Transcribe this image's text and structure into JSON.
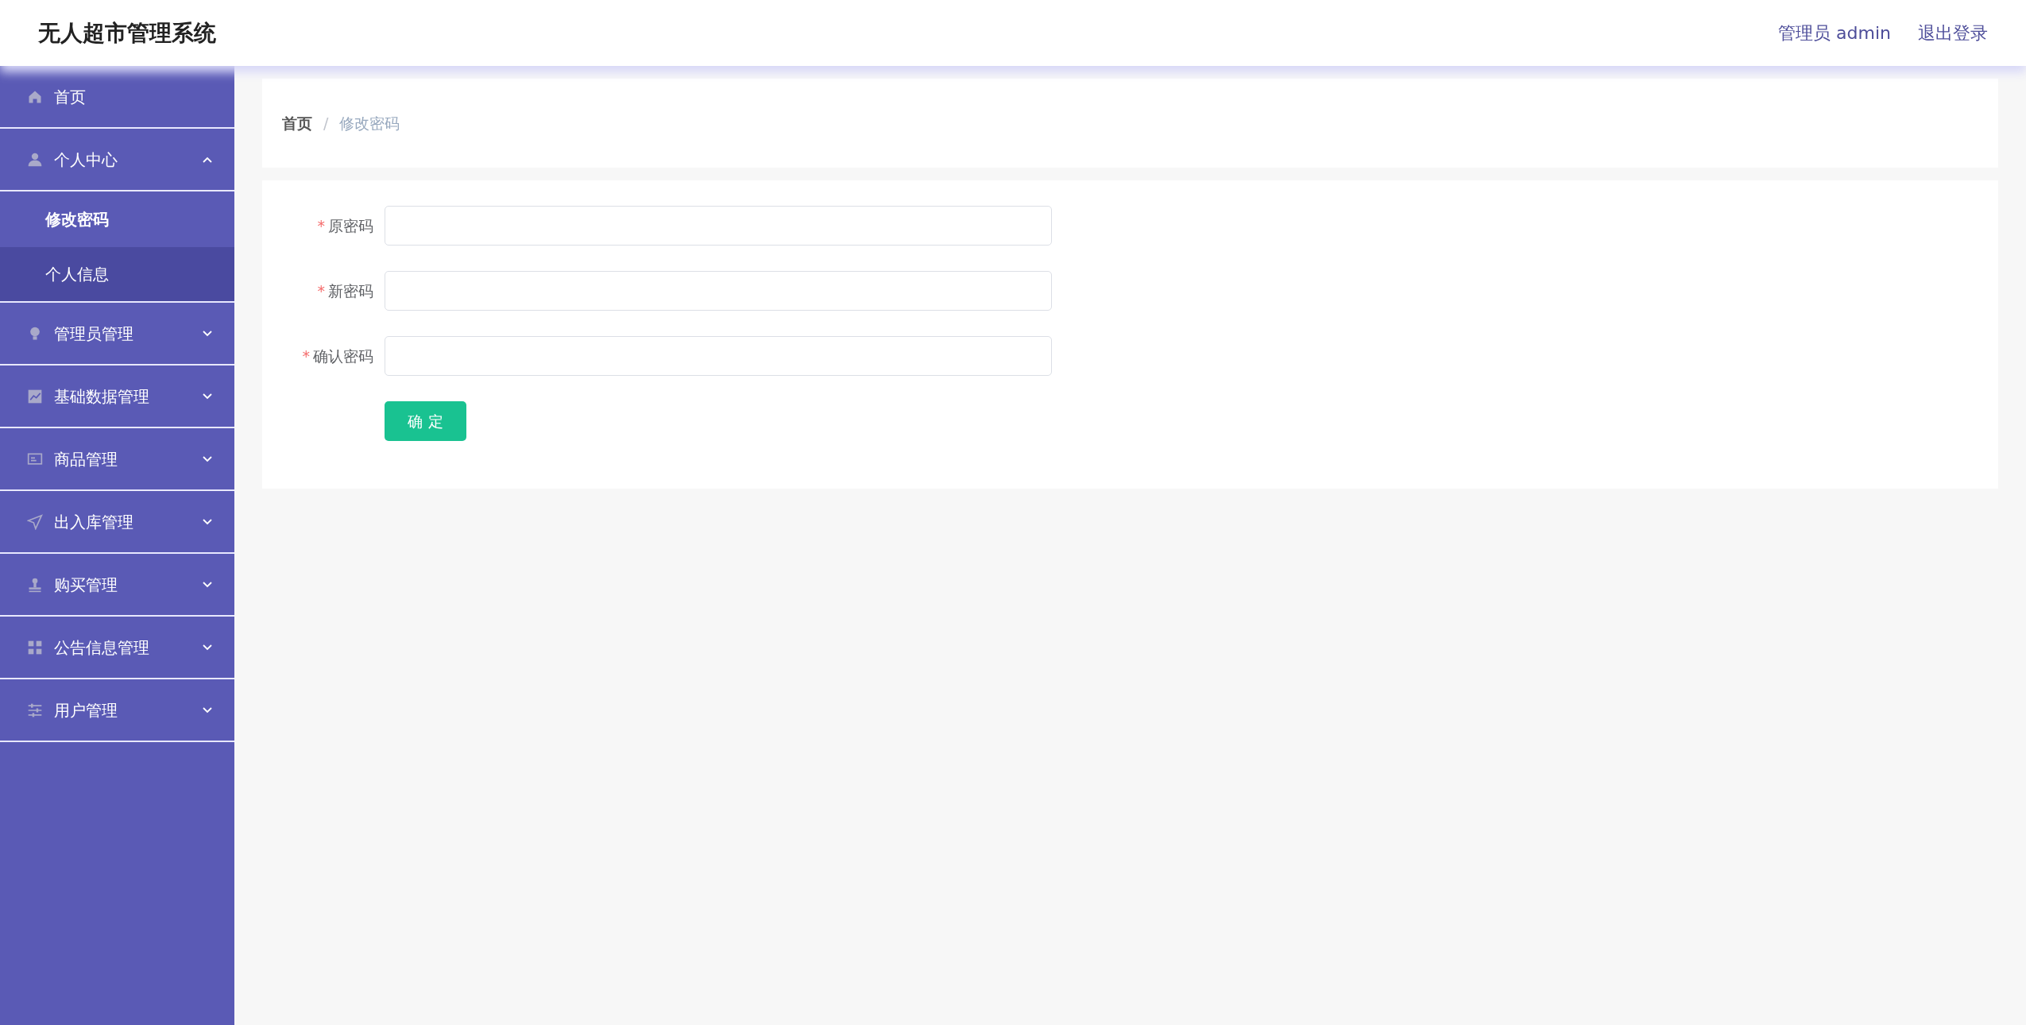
{
  "header": {
    "title": "无人超市管理系统",
    "user": "管理员 admin",
    "logout": "退出登录"
  },
  "sidebar": {
    "items": [
      {
        "label": "首页"
      },
      {
        "label": "个人中心",
        "expanded": true,
        "children": [
          {
            "label": "修改密码",
            "selected": true,
            "hovered": false
          },
          {
            "label": "个人信息",
            "selected": false,
            "hovered": true
          }
        ]
      },
      {
        "label": "管理员管理",
        "expanded": false
      },
      {
        "label": "基础数据管理",
        "expanded": false
      },
      {
        "label": "商品管理",
        "expanded": false
      },
      {
        "label": "出入库管理",
        "expanded": false
      },
      {
        "label": "购买管理",
        "expanded": false
      },
      {
        "label": "公告信息管理",
        "expanded": false
      },
      {
        "label": "用户管理",
        "expanded": false
      }
    ]
  },
  "breadcrumb": {
    "separator": "/",
    "items": [
      {
        "label": "首页",
        "selected": false
      },
      {
        "label": "修改密码",
        "selected": true
      }
    ]
  },
  "form": {
    "fields": [
      {
        "label": "原密码",
        "required": true,
        "required_mark": "*"
      },
      {
        "label": "新密码",
        "required": true,
        "required_mark": "*"
      },
      {
        "label": "确认密码",
        "required": true,
        "required_mark": "*"
      }
    ],
    "submit": "确 定"
  }
}
